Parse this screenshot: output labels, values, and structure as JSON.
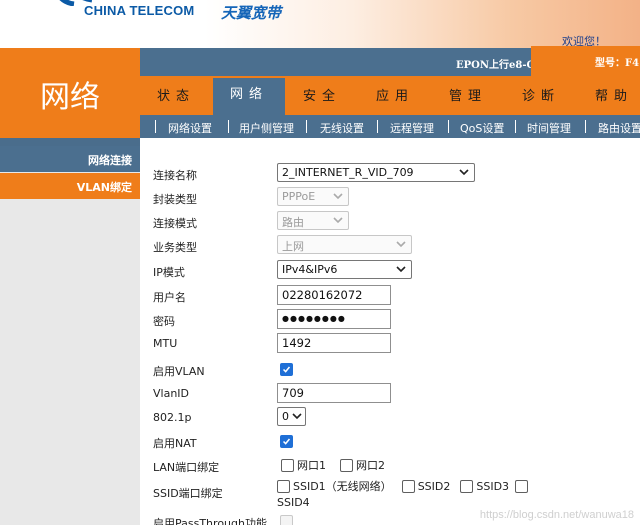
{
  "brand": {
    "name_en": "CHINA TELECOM",
    "name_cn": "天翼宽带"
  },
  "header": {
    "welcome": "欢迎您！"
  },
  "section_title": "网络",
  "info_bar": {
    "device_name": "EPON上行e8-C",
    "model_label": "型号：F4"
  },
  "tabs": [
    {
      "label": "状态",
      "active": false
    },
    {
      "label": "网络",
      "active": true
    },
    {
      "label": "安全",
      "active": false
    },
    {
      "label": "应用",
      "active": false
    },
    {
      "label": "管理",
      "active": false
    },
    {
      "label": "诊断",
      "active": false
    },
    {
      "label": "帮助",
      "active": false
    }
  ],
  "subnav": [
    "网络设置",
    "用户侧管理",
    "无线设置",
    "远程管理",
    "QoS设置",
    "时间管理",
    "路由设置"
  ],
  "side_menu": [
    {
      "label": "网络连接",
      "active": true
    },
    {
      "label": "VLAN绑定",
      "active": false
    }
  ],
  "form": {
    "connection_name": {
      "label": "连接名称",
      "value": "2_INTERNET_R_VID_709"
    },
    "encapsulation": {
      "label": "封装类型",
      "value": "PPPoE"
    },
    "connection_mode": {
      "label": "连接模式",
      "value": "路由"
    },
    "service_type": {
      "label": "业务类型",
      "value": "上网"
    },
    "ip_mode": {
      "label": "IP模式",
      "value": "IPv4&IPv6"
    },
    "username": {
      "label": "用户名",
      "value": "02280162072"
    },
    "password": {
      "label": "密码",
      "value": "●●●●●●●●"
    },
    "mtu": {
      "label": "MTU",
      "value": "1492"
    },
    "enable_vlan": {
      "label": "启用VLAN",
      "checked": true
    },
    "vlan_id": {
      "label": "VlanID",
      "value": "709"
    },
    "p8021": {
      "label": "802.1p",
      "value": "0"
    },
    "enable_nat": {
      "label": "启用NAT",
      "checked": true
    },
    "lan_binding": {
      "label": "LAN端口绑定",
      "options": [
        "网口1",
        "网口2"
      ]
    },
    "ssid_binding": {
      "label": "SSID端口绑定",
      "options": [
        "SSID1（无线网络）",
        "SSID2",
        "SSID3",
        "SSID4"
      ]
    },
    "passthrough": {
      "label": "启用PassThrough功能"
    }
  },
  "watermark": "https://blog.csdn.net/wanuwa18",
  "colors": {
    "orange": "#ef7d1a",
    "slate": "#4b6f8f",
    "check_blue": "#1f6fd6"
  }
}
